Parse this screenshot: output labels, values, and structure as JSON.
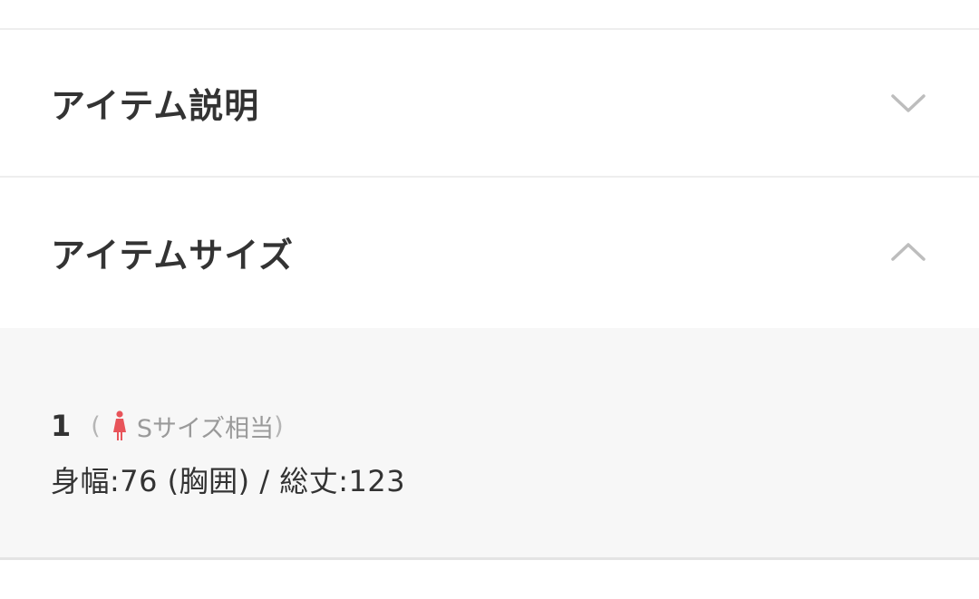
{
  "accordion": {
    "item_description": {
      "title": "アイテム説明",
      "state": "collapsed",
      "icon": "chevron-down-icon"
    },
    "item_size": {
      "title": "アイテムサイズ",
      "state": "expanded",
      "icon": "chevron-up-icon"
    }
  },
  "sizes": [
    {
      "label": "1",
      "paren_open": "(",
      "gender_icon": "woman-icon",
      "equivalent": "Sサイズ相当",
      "paren_close": ")",
      "measurements": "身幅:76 (胸囲) / 総丈:123"
    }
  ],
  "colors": {
    "divider": "#eeeeee",
    "panel_bg": "#f7f7f7",
    "text": "#333333",
    "muted": "#9a9a9a",
    "chevron": "#bdbdbd",
    "woman_icon": "#e8545a"
  }
}
